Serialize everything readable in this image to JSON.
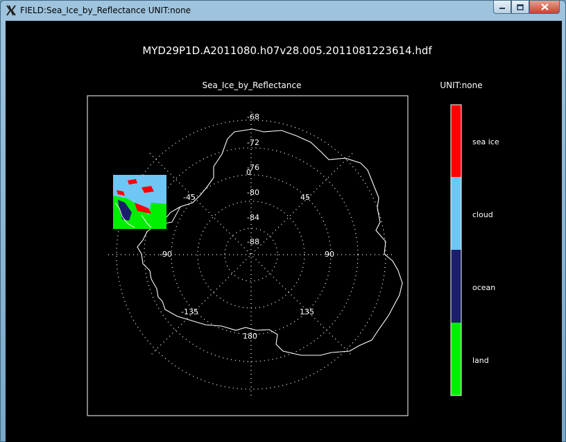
{
  "window": {
    "title": "FIELD:Sea_Ice_by_Reflectance  UNIT:none",
    "app_icon": "x-icon",
    "buttons": [
      {
        "name": "minimize-button",
        "icon": "minimize-icon"
      },
      {
        "name": "maximize-button",
        "icon": "maximize-icon"
      },
      {
        "name": "close-button",
        "icon": "close-icon"
      }
    ]
  },
  "plot": {
    "file_title": "MYD29P1D.A2011080.h07v28.005.2011081223614.hdf",
    "map_title": "Sea_Ice_by_Reflectance",
    "unit_label": "UNIT:none",
    "lat_labels": [
      "-68",
      "-72",
      "-76",
      "-80",
      "-84",
      "-88"
    ],
    "lon_labels": {
      "l0": "0",
      "l45": "45",
      "l90": "90",
      "l135": "135",
      "l180": "180",
      "lm135": "-135",
      "lm90": "-90",
      "lm45": "-45"
    }
  },
  "legend": {
    "items": [
      {
        "label": "sea ice",
        "color": "#ff0000"
      },
      {
        "label": "cloud",
        "color": "#6ec6f5"
      },
      {
        "label": "ocean",
        "color": "#1b1f6b"
      },
      {
        "label": "land",
        "color": "#00ee00"
      }
    ]
  }
}
